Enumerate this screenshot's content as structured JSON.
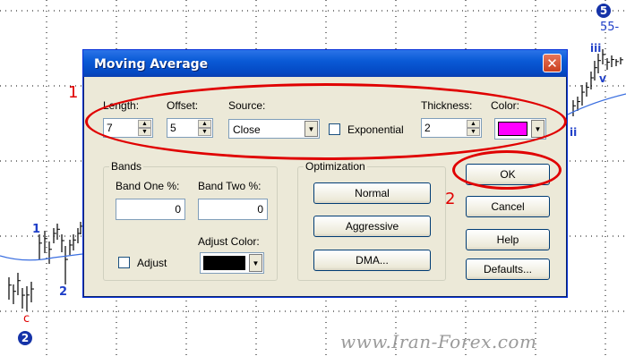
{
  "chart": {
    "wave_labels": {
      "top_circle": "5",
      "top_text": "55-",
      "iii": "iii",
      "v": "v",
      "ii": "ii",
      "one": "1",
      "two": "2",
      "c": "c",
      "bottom_circle": "2"
    },
    "colors": {
      "grid": "#000000",
      "bars": "#000000",
      "ma_line": "#3b6fe0",
      "wave_label": "#1f3fc8",
      "c_label": "#e00000"
    }
  },
  "dialog": {
    "title": "Moving Average",
    "close_glyph": "✕",
    "fields": {
      "length_label": "Length:",
      "length_value": "7",
      "offset_label": "Offset:",
      "offset_value": "5",
      "source_label": "Source:",
      "source_value": "Close",
      "exponential_label": "Exponential",
      "exponential_checked": false,
      "thickness_label": "Thickness:",
      "thickness_value": "2",
      "color_label": "Color:",
      "color_value": "#ff00ff"
    },
    "bands": {
      "title": "Bands",
      "band_one_label": "Band One %:",
      "band_one_value": "0",
      "band_two_label": "Band Two %:",
      "band_two_value": "0",
      "adjust_label": "Adjust",
      "adjust_checked": false,
      "adjust_color_label": "Adjust Color:",
      "adjust_color_value": "#000000"
    },
    "optimization": {
      "title": "Optimization",
      "buttons": [
        "Normal",
        "Aggressive",
        "DMA..."
      ]
    },
    "actions": {
      "ok": "OK",
      "cancel": "Cancel",
      "help": "Help",
      "defaults": "Defaults..."
    }
  },
  "annotations": {
    "one": "1",
    "two": "2",
    "color": "#e00000"
  },
  "watermark": "www.Iran-Forex.com"
}
